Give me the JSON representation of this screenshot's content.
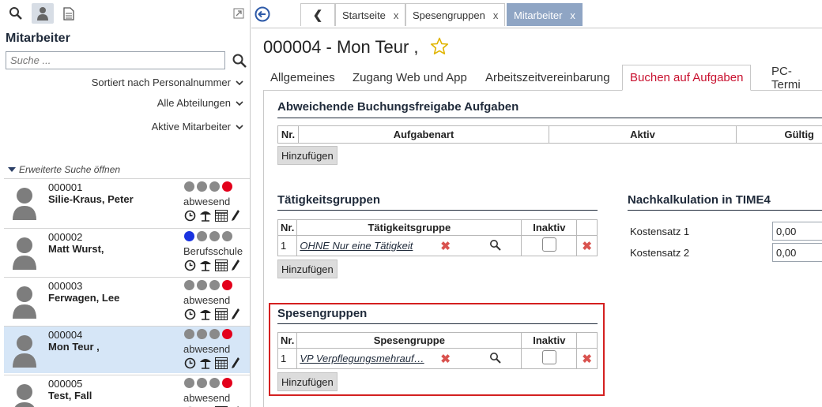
{
  "sidebar": {
    "title": "Mitarbeiter",
    "search_placeholder": "Suche ...",
    "sort_label": "Sortiert nach Personalnummer",
    "department_label": "Alle Abteilungen",
    "active_label": "Aktive Mitarbeiter",
    "extended_search": "Erweiterte Suche öffnen",
    "employees": [
      {
        "number": "000001",
        "name": "Silie-Kraus, Peter",
        "status": "abwesend",
        "dots": [
          "#8a8a8a",
          "#8a8a8a",
          "#8a8a8a",
          "#e3001b"
        ]
      },
      {
        "number": "000002",
        "name": "Matt Wurst,",
        "status": "Berufsschule",
        "dots": [
          "#1a33e0",
          "#8a8a8a",
          "#8a8a8a",
          "#8a8a8a"
        ]
      },
      {
        "number": "000003",
        "name": "Ferwagen, Lee",
        "status": "abwesend",
        "dots": [
          "#8a8a8a",
          "#8a8a8a",
          "#8a8a8a",
          "#e3001b"
        ]
      },
      {
        "number": "000004",
        "name": "Mon Teur ,",
        "status": "abwesend",
        "dots": [
          "#8a8a8a",
          "#8a8a8a",
          "#8a8a8a",
          "#e3001b"
        ],
        "selected": true
      },
      {
        "number": "000005",
        "name": "Test, Fall",
        "status": "abwesend",
        "dots": [
          "#8a8a8a",
          "#8a8a8a",
          "#8a8a8a",
          "#e3001b"
        ]
      }
    ]
  },
  "doc_tabs": [
    {
      "label": "Startseite",
      "close": "x"
    },
    {
      "label": "Spesengruppen",
      "close": "x"
    },
    {
      "label": "Mitarbeiter",
      "close": "x",
      "active": true
    }
  ],
  "doc_nav_back": "❮",
  "main": {
    "title": "000004 - Mon Teur ,",
    "tabs": [
      "Allgemeines",
      "Zugang Web und App",
      "Arbeitszeitvereinbarung",
      "Buchen auf Aufgaben",
      "PC-Termi"
    ],
    "active_tab": 3,
    "section1": {
      "title": "Abweichende Buchungsfreigabe Aufgaben",
      "headers": [
        "Nr.",
        "Aufgabenart",
        "Aktiv",
        "Gültig"
      ],
      "add_label": "Hinzufügen"
    },
    "section2": {
      "title": "Tätigkeitsgruppen",
      "headers": [
        "Nr.",
        "Tätigkeitsgruppe",
        "Inaktiv"
      ],
      "rows": [
        {
          "nr": "1",
          "value": "OHNE Nur eine Tätigkeit",
          "inactive": false
        }
      ],
      "add_label": "Hinzufügen"
    },
    "section3": {
      "title": "Nachkalkulation in TIME4",
      "fields": [
        {
          "label": "Kostensatz 1",
          "value": "0,00"
        },
        {
          "label": "Kostensatz 2",
          "value": "0,00"
        }
      ]
    },
    "section4": {
      "title": "Spesengruppen",
      "headers": [
        "Nr.",
        "Spesengruppe",
        "Inaktiv"
      ],
      "rows": [
        {
          "nr": "1",
          "value": "VP Verpflegungsmehrauf…",
          "inactive": false
        }
      ],
      "add_label": "Hinzufügen"
    },
    "highlight_color": "#d42020",
    "accent_color": "#c8102e"
  }
}
